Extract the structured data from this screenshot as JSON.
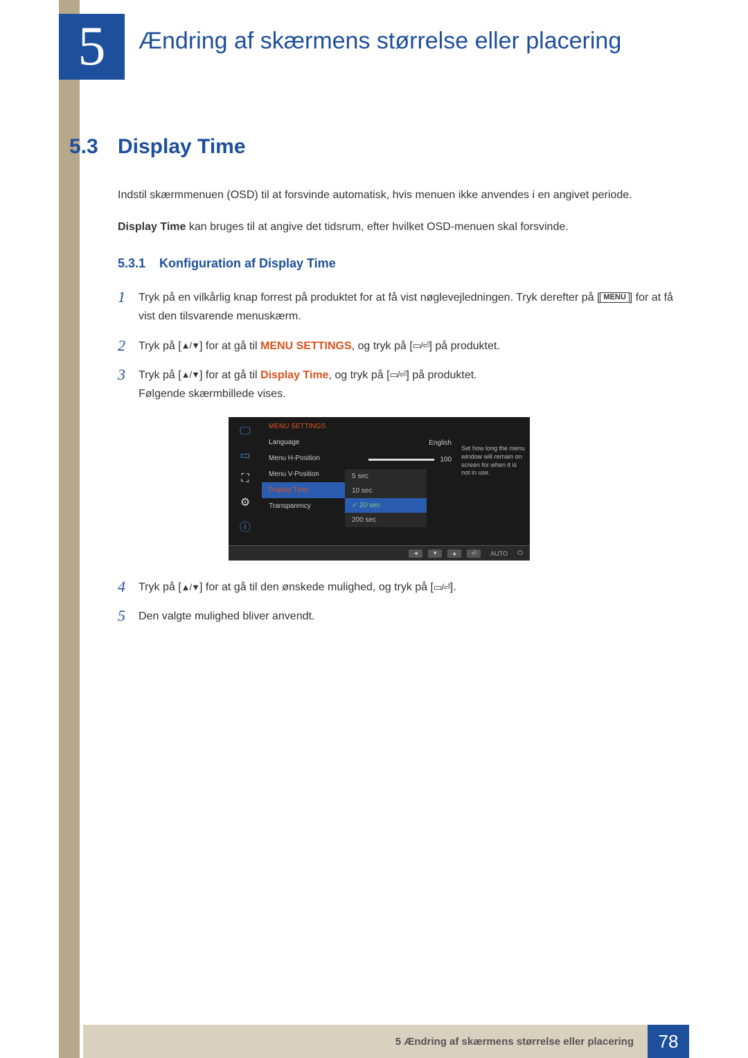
{
  "chapter": {
    "number": "5",
    "title": "Ændring af skærmens størrelse eller placering"
  },
  "section": {
    "number": "5.3",
    "title": "Display Time"
  },
  "intro1": "Indstil skærmmenuen (OSD) til at forsvinde automatisk, hvis menuen ikke anvendes i en angivet periode.",
  "intro2_bold": "Display Time",
  "intro2_rest": " kan bruges til at angive det tidsrum, efter hvilket OSD-menuen skal forsvinde.",
  "subsection": {
    "number": "5.3.1",
    "title": "Konfiguration af Display Time"
  },
  "steps": {
    "s1_num": "1",
    "s1a": "Tryk på en vilkårlig knap forrest på produktet for at få vist nøglevejledningen. Tryk derefter på [",
    "s1b": "] for at få vist den tilsvarende menuskærm.",
    "s1_menu": "MENU",
    "s2_num": "2",
    "s2a": "Tryk på [",
    "s2b": "] for at gå til ",
    "s2_target": "MENU SETTINGS",
    "s2c": ", og tryk på [",
    "s2d": "] på produktet.",
    "s3_num": "3",
    "s3a": "Tryk på [",
    "s3b": "] for at gå til ",
    "s3_target": "Display Time",
    "s3c": ", og tryk på [",
    "s3d": "] på produktet.",
    "s3e": "Følgende skærmbillede vises.",
    "s4_num": "4",
    "s4a": "Tryk på [",
    "s4b": "] for at gå til den ønskede mulighed, og tryk på [",
    "s4c": "].",
    "s5_num": "5",
    "s5": "Den valgte mulighed bliver anvendt."
  },
  "osd": {
    "header": "MENU SETTINGS",
    "menu": {
      "language": "Language",
      "hpos": "Menu H-Position",
      "vpos": "Menu V-Position",
      "displaytime": "Display Time",
      "transparency": "Transparency"
    },
    "values": {
      "language": "English",
      "hpos": "100"
    },
    "options": {
      "o1": "5 sec",
      "o2": "10 sec",
      "o3": "20 sec",
      "o4": "200 sec"
    },
    "help": "Set how long the menu window will remain on screen for when it is not in use.",
    "footer_auto": "AUTO"
  },
  "footer": {
    "text": "5 Ændring af skærmens størrelse eller placering",
    "page": "78"
  }
}
